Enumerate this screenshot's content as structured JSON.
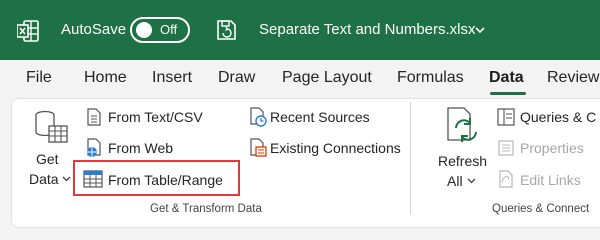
{
  "titlebar": {
    "autosave_label": "AutoSave",
    "toggle_state": "Off",
    "filename": "Separate Text and Numbers.xlsx",
    "app_icon": "excel-icon",
    "colors": {
      "bar": "#1e7045",
      "text": "#ffffff"
    }
  },
  "tabs": [
    {
      "label": "File",
      "active": false
    },
    {
      "label": "Home",
      "active": false
    },
    {
      "label": "Insert",
      "active": false
    },
    {
      "label": "Draw",
      "active": false
    },
    {
      "label": "Page Layout",
      "active": false
    },
    {
      "label": "Formulas",
      "active": false
    },
    {
      "label": "Data",
      "active": true
    },
    {
      "label": "Review",
      "active": false
    }
  ],
  "ribbon": {
    "get_data": {
      "line1": "Get",
      "line2": "Data",
      "icon": "database-table-icon"
    },
    "commands": {
      "from_text_csv": "From Text/CSV",
      "from_web": "From Web",
      "from_table_range": "From Table/Range",
      "recent_sources": "Recent Sources",
      "existing_connections": "Existing Connections"
    },
    "group_get_transform": "Get & Transform Data",
    "refresh": {
      "line1": "Refresh",
      "line2": "All"
    },
    "queries": {
      "queries_connections": "Queries & C",
      "properties": "Properties",
      "edit_links": "Edit Links"
    },
    "group_queries": "Queries & Connect",
    "highlight_color": "#e03a3a"
  }
}
